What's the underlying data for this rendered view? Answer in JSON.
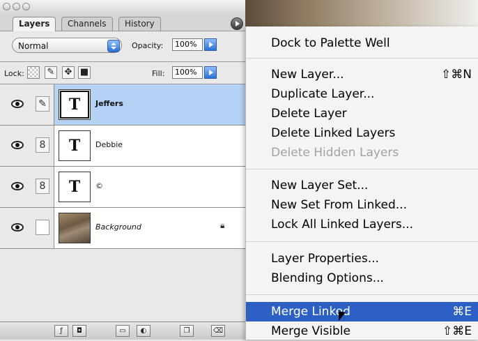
{
  "palette": {
    "tabs": [
      "Layers",
      "Channels",
      "History"
    ],
    "blend_mode": "Normal",
    "opacity_label": "Opacity:",
    "opacity_value": "100%",
    "lock_label": "Lock:",
    "fill_label": "Fill:",
    "fill_value": "100%",
    "layers": [
      {
        "name": "Jeffers",
        "thumb": "T",
        "selected": true,
        "link_glyph": "✎"
      },
      {
        "name": "Debbie",
        "thumb": "T",
        "selected": false,
        "link_glyph": "8"
      },
      {
        "name": "©",
        "thumb": "T",
        "selected": false,
        "link_glyph": "8"
      },
      {
        "name": "Background",
        "thumb": "",
        "selected": false,
        "link_glyph": "",
        "locked": true
      }
    ],
    "lock_icons": [
      "checkerboard-icon",
      "brush-icon",
      "move-icon",
      "lock-icon"
    ],
    "bottom_tools": [
      "layer-style-icon",
      "mask-icon",
      "new-set-icon",
      "adjustment-layer-icon",
      "new-layer-icon",
      "trash-icon"
    ]
  },
  "menu": {
    "items": [
      {
        "label": "Dock to Palette Well",
        "shortcut": "",
        "state": "normal"
      },
      {
        "label": "New Layer...",
        "shortcut": "⇧⌘N",
        "state": "normal"
      },
      {
        "label": "Duplicate Layer...",
        "shortcut": "",
        "state": "normal"
      },
      {
        "label": "Delete Layer",
        "shortcut": "",
        "state": "normal"
      },
      {
        "label": "Delete Linked Layers",
        "shortcut": "",
        "state": "normal"
      },
      {
        "label": "Delete Hidden Layers",
        "shortcut": "",
        "state": "disabled"
      },
      {
        "label": "New Layer Set...",
        "shortcut": "",
        "state": "normal"
      },
      {
        "label": "New Set From Linked...",
        "shortcut": "",
        "state": "normal"
      },
      {
        "label": "Lock All Linked Layers...",
        "shortcut": "",
        "state": "normal"
      },
      {
        "label": "Layer Properties...",
        "shortcut": "",
        "state": "normal"
      },
      {
        "label": "Blending Options...",
        "shortcut": "",
        "state": "normal"
      },
      {
        "label": "Merge Linked",
        "shortcut": "⌘E",
        "state": "highlighted"
      },
      {
        "label": "Merge Visible",
        "shortcut": "⇧⌘E",
        "state": "normal"
      }
    ]
  },
  "colors": {
    "selection_blue": "#b5d2f5",
    "menu_highlight": "#2c60c4",
    "disabled_text": "#a2a2a2"
  }
}
